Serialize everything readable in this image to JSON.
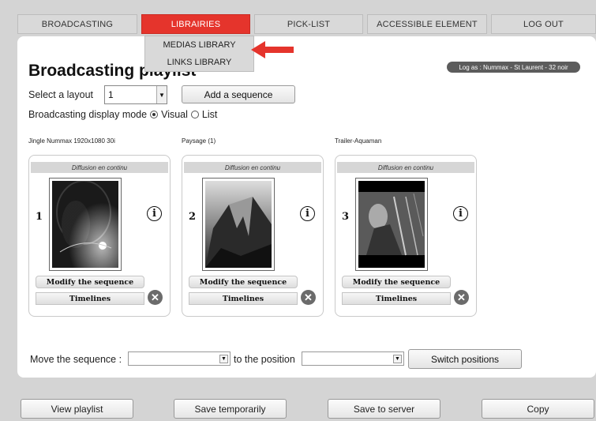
{
  "nav": {
    "tabs": [
      {
        "label": "BROADCASTING"
      },
      {
        "label": "LIBRAIRIES"
      },
      {
        "label": "PICK-LIST"
      },
      {
        "label": "ACCESSIBLE ELEMENT"
      },
      {
        "label": "LOG OUT"
      }
    ],
    "active_color": "#e5342c"
  },
  "dropdown": {
    "items": [
      {
        "label": "MEDIAS LIBRARY"
      },
      {
        "label": "LINKS LIBRARY"
      }
    ]
  },
  "page": {
    "title": "Broadcasting playlist",
    "login_info": "Log as : Nummax - St Laurent - 32 noir"
  },
  "layout": {
    "label": "Select a layout",
    "value": "1",
    "add_button": "Add a sequence"
  },
  "mode": {
    "label": "Broadcasting display mode",
    "options": [
      "Visual",
      "List"
    ],
    "selected": "Visual"
  },
  "sequences": [
    {
      "name": "Jingle Nummax 1920x1080 30i",
      "header": "Diffusion en continu",
      "number": "1",
      "modify": "Modify the sequence",
      "timelines": "Timelines"
    },
    {
      "name": "Paysage (1)",
      "header": "Diffusion en continu",
      "number": "2",
      "modify": "Modify the sequence",
      "timelines": "Timelines"
    },
    {
      "name": "Trailer-Aquaman",
      "header": "Diffusion en continu",
      "number": "3",
      "modify": "Modify the sequence",
      "timelines": "Timelines"
    }
  ],
  "move": {
    "label": "Move the sequence :",
    "to_label": "to the position",
    "switch_button": "Switch positions"
  },
  "bottom": {
    "view": "View playlist",
    "save_temp": "Save temporarily",
    "save_server": "Save to server",
    "copy": "Copy"
  }
}
